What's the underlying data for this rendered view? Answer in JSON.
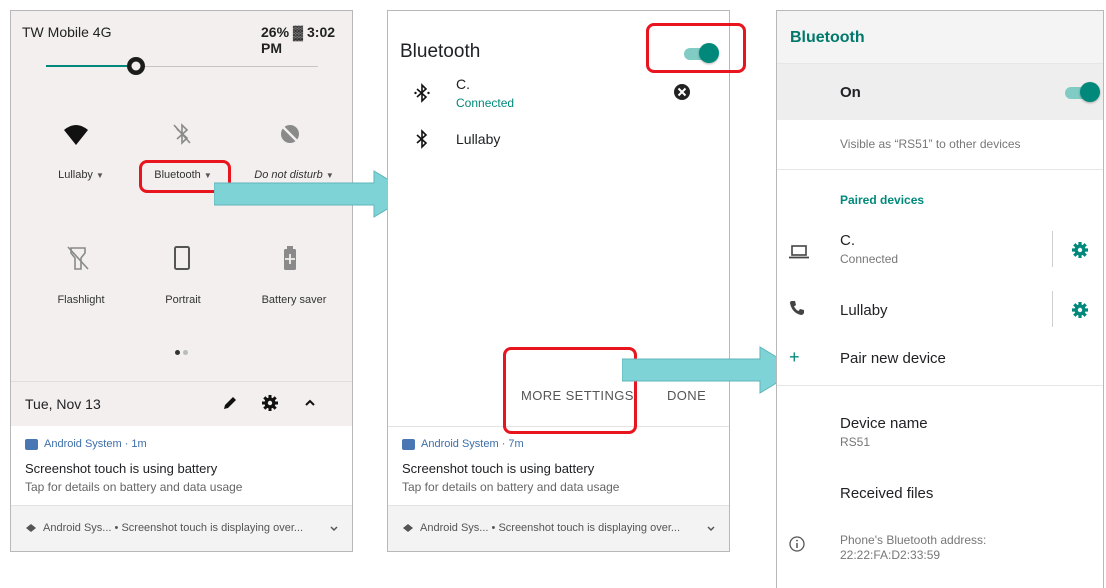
{
  "panel1": {
    "status": {
      "carrier": "TW Mobile 4G",
      "battery_time": "26% ▓ 3:02 PM"
    },
    "tiles_row1": [
      {
        "label": "Lullaby",
        "icon": "wifi-icon"
      },
      {
        "label": "Bluetooth",
        "icon": "bluetooth-off-icon"
      },
      {
        "label": "Do not disturb",
        "icon": "do-not-disturb-icon"
      }
    ],
    "tiles_row2": [
      {
        "label": "Flashlight",
        "icon": "flashlight-off-icon"
      },
      {
        "label": "Portrait",
        "icon": "portrait-icon"
      },
      {
        "label": "Battery saver",
        "icon": "battery-saver-icon"
      }
    ],
    "brightness_level": 0.33,
    "date": "Tue, Nov 13",
    "notification": {
      "app": "Android System · 1m",
      "title": "Screenshot touch is using battery",
      "text": "Tap for details on battery and data usage"
    },
    "footer": "Android Sys... • Screenshot touch is displaying over..."
  },
  "panel2": {
    "title": "Bluetooth",
    "devices": [
      {
        "name": "C.",
        "status": "Connected"
      },
      {
        "name": "Lullaby",
        "status": ""
      }
    ],
    "buttons": {
      "more_settings": "MORE SETTINGS",
      "done": "DONE"
    },
    "notification": {
      "app": "Android System · 7m",
      "title": "Screenshot touch is using battery",
      "text": "Tap for details on battery and data usage"
    },
    "footer": "Android Sys... • Screenshot touch is displaying over..."
  },
  "panel3": {
    "title": "Bluetooth",
    "on_label": "On",
    "visible_as": "Visible as “RS51” to other devices",
    "paired_header": "Paired devices",
    "paired": [
      {
        "name": "C.",
        "status": "Connected"
      },
      {
        "name": "Lullaby",
        "status": ""
      }
    ],
    "pair_new": "Pair new device",
    "device_name_label": "Device name",
    "device_name_value": "RS51",
    "received_files": "Received files",
    "address_label": "Phone's Bluetooth address:",
    "address_value": "22:22:FA:D2:33:59"
  },
  "colors": {
    "accent": "#00897b",
    "highlight": "#e8141e",
    "arrow": "#7ed3d6"
  }
}
